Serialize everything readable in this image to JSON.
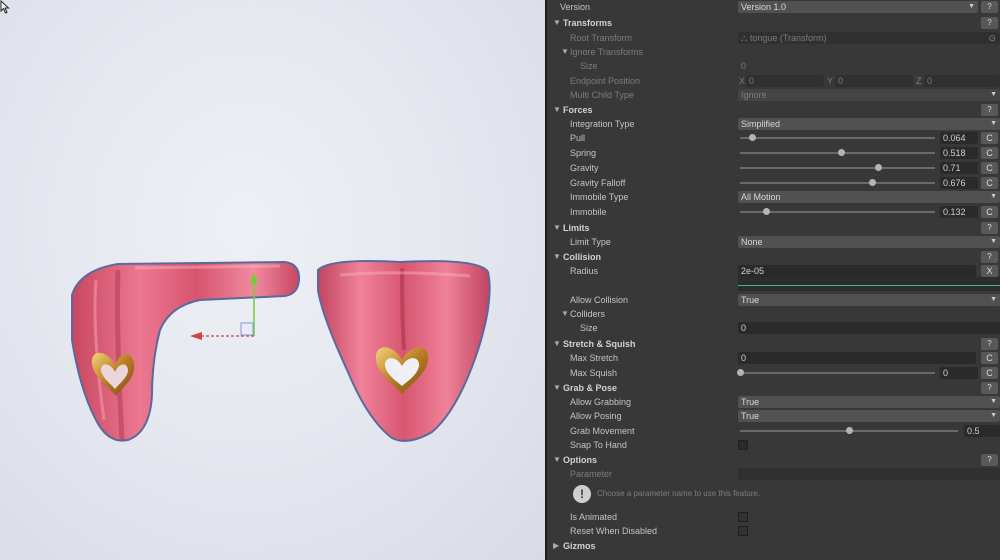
{
  "header": {
    "version_label": "Version",
    "version_value": "Version 1.0",
    "help": "?"
  },
  "transforms": {
    "title": "Transforms",
    "root_transform": {
      "label": "Root Transform",
      "value": "tongue (Transform)"
    },
    "ignore_transforms": {
      "label": "Ignore Transforms"
    },
    "size": {
      "label": "Size",
      "value": "0"
    },
    "endpoint_position": {
      "label": "Endpoint Position",
      "x_label": "X",
      "x": "0",
      "y_label": "Y",
      "y": "0",
      "z_label": "Z",
      "z": "0"
    },
    "multi_child_type": {
      "label": "Multi Child Type",
      "value": "Ignore"
    }
  },
  "forces": {
    "title": "Forces",
    "integration_type": {
      "label": "Integration Type",
      "value": "Simplified"
    },
    "pull": {
      "label": "Pull",
      "value": "0.064",
      "fraction": 0.064
    },
    "spring": {
      "label": "Spring",
      "value": "0.518",
      "fraction": 0.518
    },
    "gravity": {
      "label": "Gravity",
      "value": "0.71",
      "fraction": 0.71
    },
    "gravity_falloff": {
      "label": "Gravity Falloff",
      "value": "0.676",
      "fraction": 0.676
    },
    "immobile_type": {
      "label": "Immobile Type",
      "value": "All Motion"
    },
    "immobile": {
      "label": "Immobile",
      "value": "0.132",
      "fraction": 0.132
    }
  },
  "limits": {
    "title": "Limits",
    "limit_type": {
      "label": "Limit Type",
      "value": "None"
    }
  },
  "collision": {
    "title": "Collision",
    "radius": {
      "label": "Radius",
      "value": "2e-05",
      "clear": "X"
    },
    "allow_collision": {
      "label": "Allow Collision",
      "value": "True"
    },
    "colliders": {
      "label": "Colliders"
    },
    "size": {
      "label": "Size",
      "value": "0"
    }
  },
  "stretch": {
    "title": "Stretch & Squish",
    "max_stretch": {
      "label": "Max Stretch",
      "value": "0"
    },
    "max_squish": {
      "label": "Max Squish",
      "value": "0",
      "fraction": 0.0
    }
  },
  "grab": {
    "title": "Grab & Pose",
    "allow_grabbing": {
      "label": "Allow Grabbing",
      "value": "True"
    },
    "allow_posing": {
      "label": "Allow Posing",
      "value": "True"
    },
    "grab_movement": {
      "label": "Grab Movement",
      "value": "0.5",
      "fraction": 0.5
    },
    "snap_to_hand": {
      "label": "Snap To Hand"
    }
  },
  "options": {
    "title": "Options",
    "parameter": {
      "label": "Parameter"
    },
    "info": "Choose a parameter name to use this feature.",
    "is_animated": {
      "label": "Is Animated"
    },
    "reset_when_disabled": {
      "label": "Reset When Disabled"
    }
  },
  "gizmos": {
    "title": "Gizmos"
  },
  "reset_button": "C",
  "colors": {
    "tongue": "#e2607a",
    "heart": "#c8962c",
    "gizmo_y": "#6fcf3a",
    "gizmo_x": "#d94040",
    "editor_bg": "#383838"
  }
}
